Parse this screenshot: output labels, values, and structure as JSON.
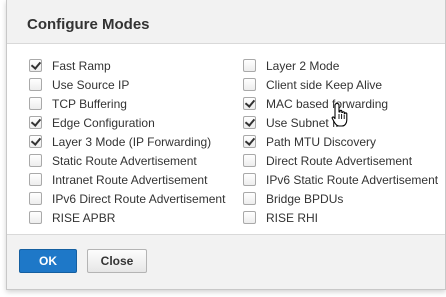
{
  "dialog": {
    "title": "Configure Modes",
    "ok_label": "OK",
    "close_label": "Close"
  },
  "left_column": [
    {
      "label": "Fast Ramp",
      "checked": true
    },
    {
      "label": "Use Source IP",
      "checked": false
    },
    {
      "label": "TCP Buffering",
      "checked": false
    },
    {
      "label": "Edge Configuration",
      "checked": true
    },
    {
      "label": "Layer 3 Mode (IP Forwarding)",
      "checked": true
    },
    {
      "label": "Static Route Advertisement",
      "checked": false
    },
    {
      "label": "Intranet Route Advertisement",
      "checked": false
    },
    {
      "label": "IPv6 Direct Route Advertisement",
      "checked": false
    },
    {
      "label": "RISE APBR",
      "checked": false
    }
  ],
  "right_column": [
    {
      "label": "Layer 2 Mode",
      "checked": false
    },
    {
      "label": "Client side Keep Alive",
      "checked": false
    },
    {
      "label": "MAC based forwarding",
      "checked": true
    },
    {
      "label": "Use Subnet IP",
      "checked": true
    },
    {
      "label": "Path MTU Discovery",
      "checked": true
    },
    {
      "label": "Direct Route Advertisement",
      "checked": false
    },
    {
      "label": "IPv6 Static Route Advertisement",
      "checked": false
    },
    {
      "label": "Bridge BPDUs",
      "checked": false
    },
    {
      "label": "RISE RHI",
      "checked": false
    }
  ],
  "colors": {
    "primary_button": "#1e78c8",
    "header_background": "#f2f2f2"
  },
  "cursor": "hand-pointer-icon"
}
